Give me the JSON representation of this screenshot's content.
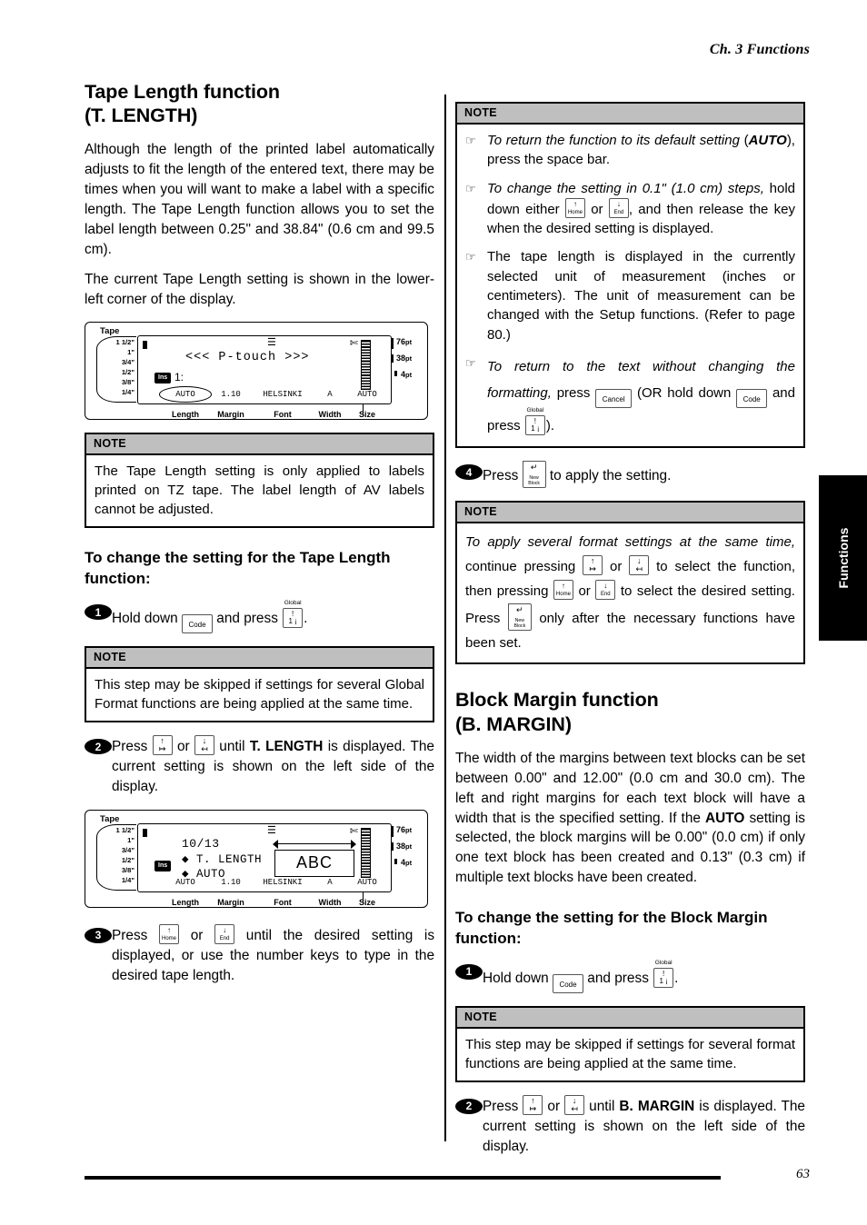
{
  "header": {
    "chapter": "Ch. 3 Functions"
  },
  "footer": {
    "page_number": "63"
  },
  "side_tab": {
    "label": "Functions"
  },
  "left_column": {
    "section_title_line1": "Tape Length function",
    "section_title_line2": "(T. LENGTH)",
    "para1": "Although the length of the printed label automatically adjusts to fit the length of the entered text, there may be times when you will want to make a label with a specific length. The Tape Length function allows you to set the label length between 0.25\" and 38.84\" (0.6 cm and 99.5 cm).",
    "para2": "The current Tape Length setting is shown in the lower-left corner of the display.",
    "note1": {
      "header": "NOTE",
      "text": "The Tape Length setting is only applied to labels printed on TZ tape. The label length of AV labels cannot be adjusted."
    },
    "subheading": "To change the setting for the Tape Length function:",
    "step1": {
      "num": "1",
      "pre": "Hold down",
      "mid": "and press",
      "post": "."
    },
    "note2": {
      "header": "NOTE",
      "text": "This step may be skipped if settings for several Global Format functions are being applied at the same time."
    },
    "step2": {
      "num": "2",
      "pre": "Press",
      "or": "or",
      "mid": "until",
      "bold": "T. LENGTH",
      "post": "is displayed. The current setting is shown on the left side of the display."
    },
    "step3": {
      "num": "3",
      "pre": "Press",
      "or": "or",
      "post": "until the desired setting is displayed, or use the number keys to type in the desired tape length."
    }
  },
  "right_column": {
    "note1": {
      "header": "NOTE",
      "bullets": [
        {
          "icon": "pointing-hand",
          "italic1": "To return the function to its default setting",
          "bold": "AUTO",
          "rest": "press the space bar."
        },
        {
          "icon": "pointing-hand",
          "italic1": "To change the setting in 0.1\" (1.0 cm) steps,",
          "rest": "hold down either",
          "rest2": "or",
          "rest3": ", and then release the key when the desired setting is displayed."
        },
        {
          "icon": "pointing-hand",
          "text": "The tape length is displayed in the currently selected unit of measurement (inches or centimeters). The unit of measurement can be changed with the Setup functions. (Refer to page 80.)"
        },
        {
          "icon": "pointing-hand",
          "italic1": "To return to the text without changing the formatting,",
          "rest": "press",
          "rest2": "(OR hold down",
          "rest3": "and press",
          "rest4": ")."
        }
      ]
    },
    "step4": {
      "num": "4",
      "pre": "Press",
      "post": "to apply the setting."
    },
    "note2": {
      "header": "NOTE",
      "italic_lead": "To apply several format settings at the same time,",
      "l2a": "continue pressing",
      "l2or": "or",
      "l2b": "to select the function,",
      "l3a": "then pressing",
      "l3or": "or",
      "l3b": "to select the desired setting.",
      "l4a": "Press",
      "l4b": "only after the necessary functions have been set."
    },
    "section_title_line1": "Block Margin function",
    "section_title_line2": "(B. MARGIN)",
    "para1": "The width of the margins between text blocks can be set between 0.00\" and 12.00\" (0.0 cm and 30.0 cm). The left and right margins for each text block will have a width that is the specified setting. If the",
    "para1_bold": "AUTO",
    "para1_cont": "setting is selected, the block margins will be 0.00\" (0.0 cm) if only one text block has been created and 0.13\" (0.3 cm) if multiple text blocks have been created.",
    "subheading": "To change the setting for the Block Margin function:",
    "step1": {
      "num": "1",
      "pre": "Hold down",
      "mid": "and press",
      "post": "."
    },
    "note3": {
      "header": "NOTE",
      "text": "This step may be skipped if settings for several format functions are being applied at the same time."
    },
    "step2": {
      "num": "2",
      "pre": "Press",
      "or": "or",
      "mid": "until",
      "bold": "B. MARGIN",
      "post": "is displayed. The current setting is shown on the left side of the display."
    }
  },
  "keys": {
    "code": "Code",
    "cancel": "Cancel",
    "global_label": "Global",
    "global_top": "!",
    "global_bottom": "1  ¡",
    "home_arrow": "↑",
    "home_label": "Home",
    "end_arrow": "↓",
    "end_label": "End",
    "left_top": "↑",
    "left_bottom": "↦",
    "right_top": "↓",
    "right_bottom": "↤",
    "newblock_glyph": "↵",
    "newblock_l1": "New",
    "newblock_l2": "Block"
  },
  "figure1": {
    "tape_label": "Tape",
    "tape_scale": [
      "1 1/2\"",
      "1\"",
      "3/4\"",
      "1/2\"",
      "3/8\"",
      "1/4\""
    ],
    "ins_badge": "Ins",
    "line_number": "1:",
    "display_text": "<<< P-touch >>>",
    "align_icon": "align-icon",
    "scissors_icon": "scissors-icon",
    "pt_sizes": [
      "76",
      "38",
      "4"
    ],
    "pt_unit": "pt",
    "status_values": [
      "AUTO",
      "1.10",
      "HELSINKI",
      "A",
      "AUTO"
    ],
    "status_labels": [
      "Length",
      "Margin",
      "Font",
      "Width",
      "Size"
    ]
  },
  "figure2": {
    "tape_label": "Tape",
    "tape_scale": [
      "1 1/2\"",
      "1\"",
      "3/4\"",
      "1/2\"",
      "3/8\"",
      "1/4\""
    ],
    "ins_badge": "Ins",
    "counter": "10/13",
    "func_cursor": "◆",
    "func_name": "T. LENGTH",
    "value_cursor": "◆",
    "value": "AUTO",
    "preview_text": "ABC",
    "align_icon": "align-icon",
    "scissors_icon": "scissors-icon",
    "pt_sizes": [
      "76",
      "38",
      "4"
    ],
    "pt_unit": "pt",
    "status_values": [
      "AUTO",
      "1.10",
      "HELSINKI",
      "A",
      "AUTO"
    ],
    "status_labels": [
      "Length",
      "Margin",
      "Font",
      "Width",
      "Size"
    ]
  }
}
